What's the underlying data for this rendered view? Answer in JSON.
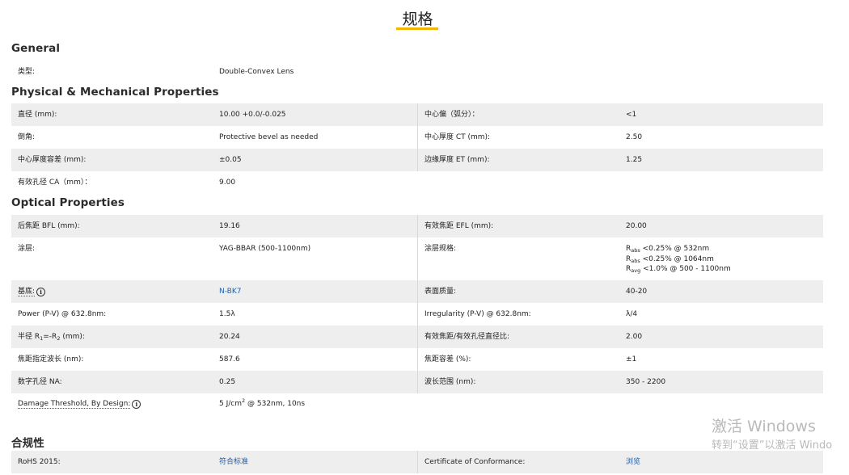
{
  "page_title": "规格",
  "sections": {
    "general": "General",
    "physical": "Physical & Mechanical Properties",
    "optical": "Optical Properties",
    "compliance": "合规性"
  },
  "general": {
    "type_label": "类型:",
    "type_value": "Double-Convex Lens"
  },
  "physical": {
    "diameter_label": "直径 (mm):",
    "diameter_value": "10.00 +0.0/-0.025",
    "centering_label": "中心偏（弧分）：",
    "centering_value": "<1",
    "bevel_label": "倒角:",
    "bevel_value": "Protective bevel as needed",
    "ct_label": "中心厚度 CT (mm):",
    "ct_value": "2.50",
    "ct_tol_label": "中心厚度容差 (mm):",
    "ct_tol_value": "±0.05",
    "et_label": "边缘厚度 ET (mm):",
    "et_value": "1.25",
    "ca_label": "有效孔径 CA（mm）：",
    "ca_value": "9.00"
  },
  "optical": {
    "bfl_label": "后焦距 BFL (mm):",
    "bfl_value": "19.16",
    "efl_label": "有效焦距 EFL (mm):",
    "efl_value": "20.00",
    "coating_label": "涂层:",
    "coating_value": "YAG-BBAR (500-1100nm)",
    "coating_spec_label": "涂层规格:",
    "coating_spec": {
      "r1_sym": "R",
      "r1_sub": "abs",
      "r1_text": " <0.25% @ 532nm",
      "r2_sym": "R",
      "r2_sub": "abs",
      "r2_text": " <0.25% @ 1064nm",
      "r3_sym": "R",
      "r3_sub": "avg",
      "r3_text": " <1.0% @ 500 - 1100nm"
    },
    "substrate_label": "基底:",
    "substrate_value": "N-BK7",
    "surface_label": "表面质量:",
    "surface_value": "40-20",
    "power_label": "Power (P-V) @ 632.8nm:",
    "power_value": "1.5λ",
    "irregularity_label": "Irregularity (P-V) @ 632.8nm:",
    "irregularity_value": "λ/4",
    "radius_label_a": "半径 R",
    "radius_sub_1": "1",
    "radius_label_b": "=-R",
    "radius_sub_2": "2",
    "radius_label_c": " (mm):",
    "radius_value": "20.24",
    "f_number_label": "有效焦距/有效孔径直径比:",
    "f_number_value": "2.00",
    "design_wl_label": "焦距指定波长 (nm):",
    "design_wl_value": "587.6",
    "focal_tol_label": "焦距容差 (%):",
    "focal_tol_value": "±1",
    "na_label": "数字孔径 NA:",
    "na_value": "0.25",
    "wl_range_label": "波长范围 (nm):",
    "wl_range_value": "350 - 2200",
    "damage_label": "Damage Threshold, By Design:",
    "damage_value_a": "5 J/cm",
    "damage_value_sup": "2",
    "damage_value_b": " @ 532nm, 10ns"
  },
  "compliance": {
    "rohs_label": "RoHS 2015:",
    "rohs_value": "符合标准",
    "coc_label": "Certificate of Conformance:",
    "coc_value": "浏览"
  },
  "info_icon_glyph": "i",
  "icons": [
    "info-icon"
  ],
  "colors": {
    "accent": "#f5b400",
    "link": "#1f5fa8",
    "row_shade": "#eeeeee"
  },
  "watermark": {
    "line1": "激活 Windows",
    "line2": "转到“设置”以激活 Windo"
  }
}
